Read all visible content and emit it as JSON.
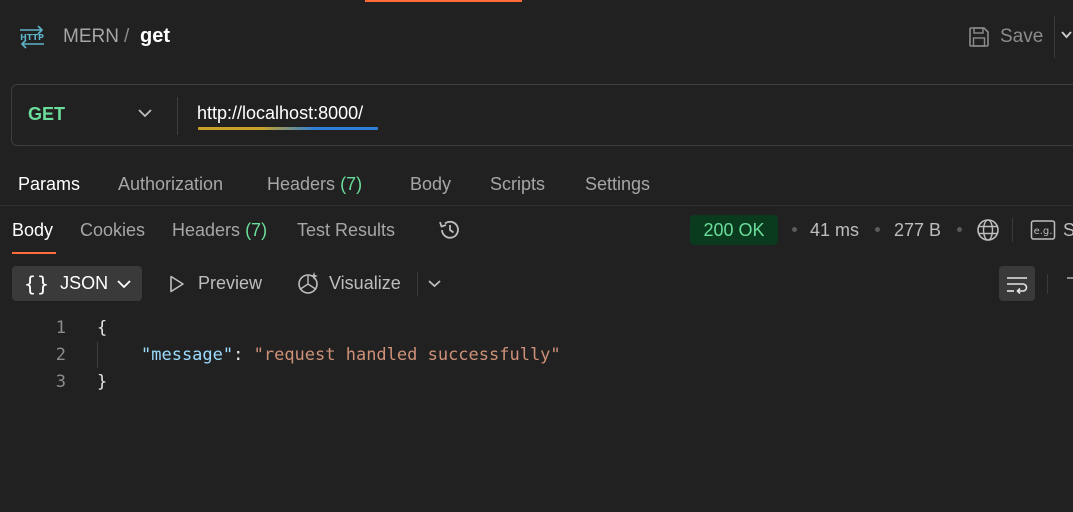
{
  "header": {
    "icon": "http-icon",
    "collection": "MERN",
    "separator": "/",
    "request_name": "get",
    "save_label": "Save"
  },
  "url_bar": {
    "method": "GET",
    "url": "http://localhost:8000/"
  },
  "request_tabs": [
    {
      "label": "Params",
      "active": true
    },
    {
      "label": "Authorization"
    },
    {
      "label": "Headers",
      "count": "(7)"
    },
    {
      "label": "Body"
    },
    {
      "label": "Scripts"
    },
    {
      "label": "Settings"
    }
  ],
  "response_tabs": [
    {
      "label": "Body",
      "active": true
    },
    {
      "label": "Cookies"
    },
    {
      "label": "Headers",
      "count": "(7)"
    },
    {
      "label": "Test Results"
    }
  ],
  "response_meta": {
    "status": "200 OK",
    "time": "41 ms",
    "size": "277 B",
    "example_label": "S"
  },
  "body_toolbar": {
    "format": "JSON",
    "preview": "Preview",
    "visualize": "Visualize"
  },
  "code": {
    "line_numbers": [
      "1",
      "2",
      "3"
    ],
    "open_brace": "{",
    "key": "\"message\"",
    "colon": ": ",
    "value": "\"request handled successfully\"",
    "close_brace": "}"
  },
  "colors": {
    "accent": "#ff6c37",
    "method": "#6bdd9a",
    "status_bg": "#0b3b1f",
    "json_key": "#9cdcfe",
    "json_string": "#ce9178"
  }
}
